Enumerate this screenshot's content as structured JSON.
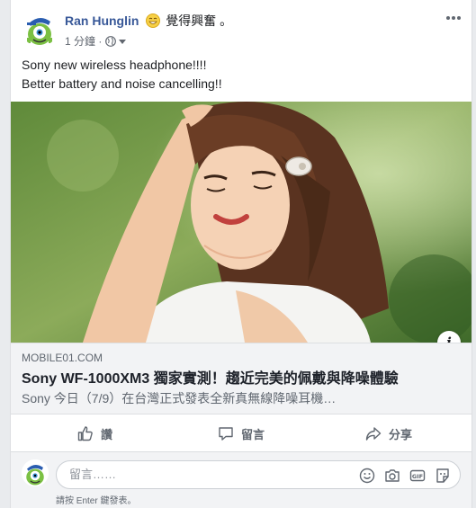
{
  "post": {
    "author": "Ran Hunglin",
    "feeling": "覺得興奮 。",
    "time": "1 分鐘 ·",
    "text": "Sony new wireless headphone!!!!\nBetter battery and noise cancelling!!"
  },
  "link": {
    "domain": "MOBILE01.COM",
    "title": "Sony WF-1000XM3 獨家實測！趨近完美的佩戴與降噪體驗",
    "description": "Sony 今日（7/9）在台灣正式發表全新真無線降噪耳機…"
  },
  "actions": {
    "like": "讚",
    "comment": "留言",
    "share": "分享"
  },
  "comment_box": {
    "placeholder": "留言……",
    "hint": "請按 Enter 鍵發表。"
  },
  "icons": [
    "monster-avatar-icon",
    "grin-emoji-icon",
    "globe-icon",
    "more-icon",
    "info-icon",
    "thumbs-up-icon",
    "comment-bubble-icon",
    "share-arrow-icon",
    "smiley-icon",
    "camera-icon",
    "gif-icon",
    "sticker-icon"
  ],
  "colors": {
    "author": "#385898",
    "meta": "#616770",
    "link_bg": "#f2f3f5"
  }
}
